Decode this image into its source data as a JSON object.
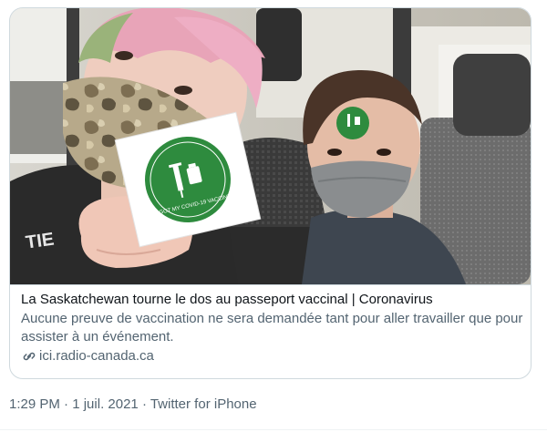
{
  "card": {
    "title": "La Saskatchewan tourne le dos au passeport vaccinal | Coronavirus",
    "description": "Aucune preuve de vaccination ne sera demandée tant pour aller travailler que pour assister à un événement.",
    "domain": "ici.radio-canada.ca",
    "link_icon": "link-icon",
    "sticker_text": "I GOT MY COVID-19 VACCINE",
    "shirt_text": "TIE"
  },
  "meta": {
    "time": "1:29 PM",
    "separator1": " · ",
    "date": "1 juil. 2021",
    "separator2": " · ",
    "source": "Twitter for iPhone"
  },
  "colors": {
    "border": "#cfd9de",
    "secondary_text": "#536471",
    "primary_text": "#0f1419",
    "sticker_green": "#2e8b3e"
  }
}
